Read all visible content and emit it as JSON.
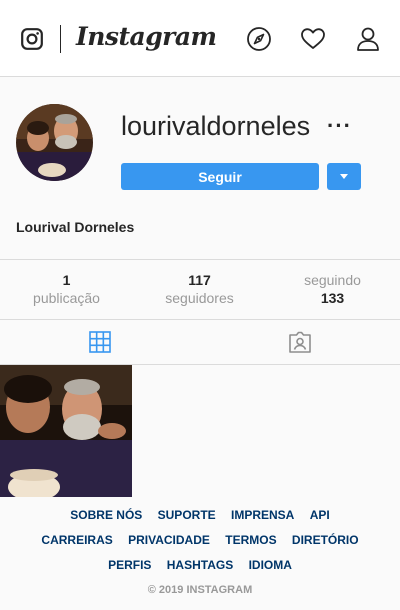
{
  "header": {
    "wordmark": "Instagram",
    "icons": [
      "instagram-logo-icon",
      "compass-icon",
      "heart-icon",
      "user-icon"
    ]
  },
  "profile": {
    "username": "lourivaldorneles",
    "more": "···",
    "follow_label": "Seguir",
    "full_name": "Lourival Dorneles"
  },
  "stats": [
    {
      "value": "1",
      "label": "publicação"
    },
    {
      "value": "117",
      "label": "seguidores"
    },
    {
      "label": "seguindo",
      "value": "133"
    }
  ],
  "tabs": [
    "grid-icon",
    "tagged-icon"
  ],
  "footer": {
    "row1": [
      "SOBRE NÓS",
      "SUPORTE",
      "IMPRENSA",
      "API"
    ],
    "row2": [
      "CARREIRAS",
      "PRIVACIDADE",
      "TERMOS",
      "DIRETÓRIO"
    ],
    "row3": [
      "PERFIS",
      "HASHTAGS",
      "IDIOMA"
    ],
    "copyright": "© 2019 INSTAGRAM"
  },
  "colors": {
    "accent": "#3897f0",
    "link": "#003569",
    "muted": "#999999",
    "border": "#dbdbdb"
  }
}
